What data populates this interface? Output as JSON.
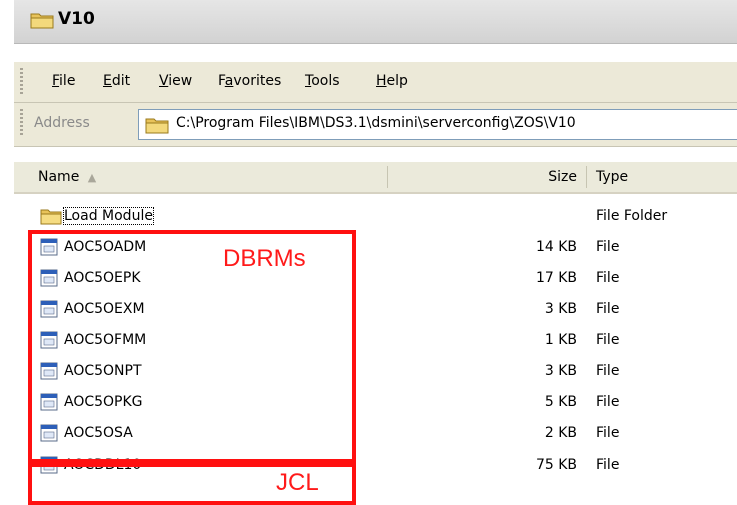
{
  "window": {
    "title": "V10"
  },
  "menu": {
    "items": [
      {
        "label": "File",
        "access_key": "F"
      },
      {
        "label": "Edit",
        "access_key": "E"
      },
      {
        "label": "View",
        "access_key": "V"
      },
      {
        "label": "Favorites",
        "access_key": "a"
      },
      {
        "label": "Tools",
        "access_key": "T"
      },
      {
        "label": "Help",
        "access_key": "H"
      }
    ]
  },
  "address": {
    "label": "Address",
    "path": "C:\\Program Files\\IBM\\DS3.1\\dsmini\\serverconfig\\ZOS\\V10"
  },
  "columns": {
    "name": "Name",
    "size": "Size",
    "type": "Type",
    "sort_indicator": "▲"
  },
  "files": [
    {
      "name": "Load Module",
      "size": "",
      "type": "File Folder",
      "icon": "folder-icon"
    },
    {
      "name": "AOC5OADM",
      "size": "14 KB",
      "type": "File",
      "icon": "file-icon"
    },
    {
      "name": "AOC5OEPK",
      "size": "17 KB",
      "type": "File",
      "icon": "file-icon"
    },
    {
      "name": "AOC5OEXM",
      "size": "3 KB",
      "type": "File",
      "icon": "file-icon"
    },
    {
      "name": "AOC5OFMM",
      "size": "1 KB",
      "type": "File",
      "icon": "file-icon"
    },
    {
      "name": "AOC5ONPT",
      "size": "3 KB",
      "type": "File",
      "icon": "file-icon"
    },
    {
      "name": "AOC5OPKG",
      "size": "5 KB",
      "type": "File",
      "icon": "file-icon"
    },
    {
      "name": "AOC5OSA",
      "size": "2 KB",
      "type": "File",
      "icon": "file-icon"
    },
    {
      "name": "AOCDDL10",
      "size": "75 KB",
      "type": "File",
      "icon": "file-icon"
    }
  ],
  "annotations": {
    "dbrms": "DBRMs",
    "jcl": "JCL",
    "color": "#ff1010"
  }
}
